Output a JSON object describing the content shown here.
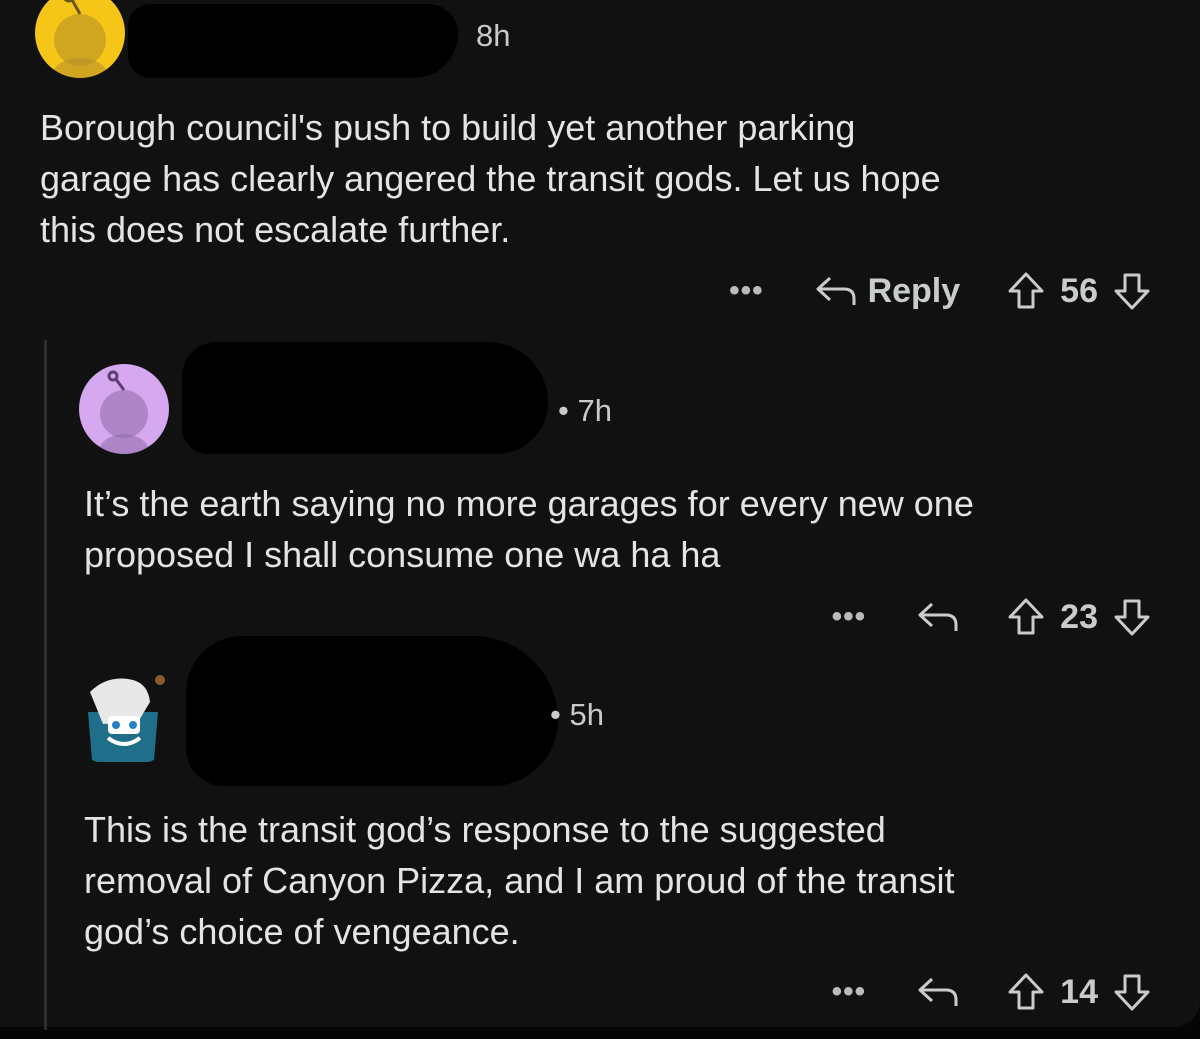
{
  "comments": [
    {
      "time": "8h",
      "body": "Borough council's push to build yet another parking\ngarage has clearly angered the transit gods.  Let us hope\nthis does not escalate further.",
      "reply_label": "Reply",
      "score": "56",
      "more": "•••"
    },
    {
      "time": "• 7h",
      "body": "It’s the earth saying no more garages for every new one\nproposed I shall consume one wa ha ha",
      "score": "23",
      "more": "•••"
    },
    {
      "time": "• 5h",
      "body": "This is the transit god’s response to the suggested\nremoval of Canyon Pizza, and I am proud of the transit\ngod’s choice of vengeance.",
      "score": "14",
      "more": "•••"
    }
  ],
  "colors": {
    "background": "#111111",
    "avatar_1": "#f5c518",
    "avatar_2": "#d6a8f0",
    "text": "#e2e4e6"
  }
}
